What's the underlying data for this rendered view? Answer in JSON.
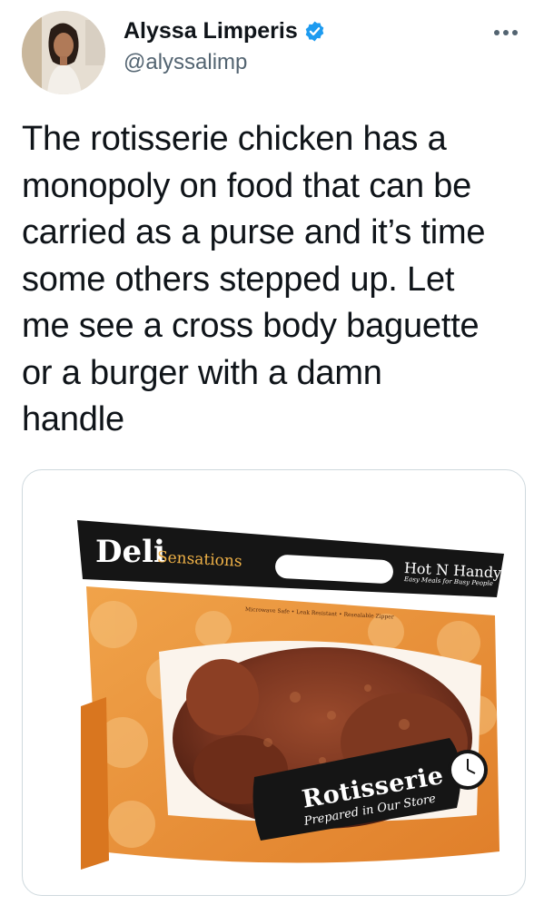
{
  "tweet": {
    "author": {
      "display_name": "Alyssa Limperis",
      "handle": "@alyssalimp",
      "verified": true
    },
    "text": "The rotisserie chicken has a\nmonopoly on food that can be\ncarried as a purse and it’s time\nsome others stepped up. Let\nme see a cross body baguette\nor a burger with a damn\nhandle",
    "media": {
      "bag": {
        "brand_main": "Deli",
        "brand_secondary": "Sensations",
        "handle_label": "Hot N Handy",
        "handle_tagline": "Easy Meals for Busy People",
        "features": "Microwave Safe • Leak Resistant • Resealable Zipper",
        "label_title": "Rotisserie",
        "label_subtitle": "Prepared in Our Store"
      }
    }
  },
  "icons": {
    "verified": "verified-badge-icon",
    "more": "more-options-icon"
  },
  "colors": {
    "verified_blue": "#1d9bf0",
    "secondary_text": "#536471",
    "border": "#cfd9de",
    "bag_orange": "#e8953c",
    "bag_black": "#151515"
  }
}
